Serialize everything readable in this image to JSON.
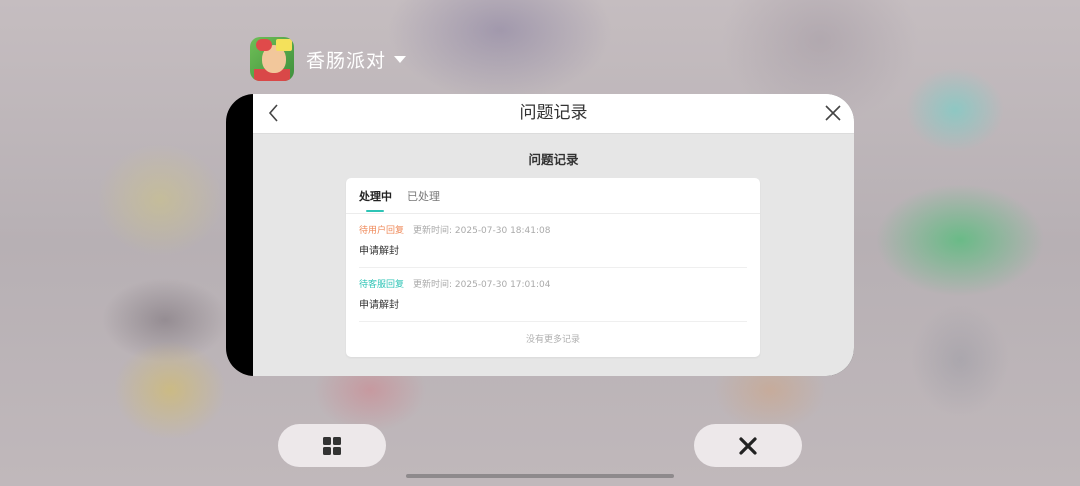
{
  "app": {
    "name": "香肠派对",
    "icon": "sausage-party-app-icon"
  },
  "window": {
    "title": "问题记录",
    "back_icon": "chevron-left-icon",
    "close_icon": "close-icon",
    "section_title": "问题记录",
    "tabs": [
      {
        "label": "处理中",
        "active": true
      },
      {
        "label": "已处理",
        "active": false
      }
    ],
    "records": [
      {
        "status": "待用户回复",
        "time": "更新时间: 2025-07-30 18:41:08",
        "content": "申请解封",
        "status_color": "#ef8a5a"
      },
      {
        "status": "待客服回复",
        "time": "更新时间: 2025-07-30 17:01:04",
        "content": "申请解封",
        "status_color": "#2ec4b6"
      }
    ],
    "no_more": "没有更多记录"
  },
  "bottom_bar": {
    "left_icon": "grid-icon",
    "right_icon": "close-icon"
  },
  "colors": {
    "accent": "#2ec4b6",
    "pending_user": "#ef8a5a"
  }
}
